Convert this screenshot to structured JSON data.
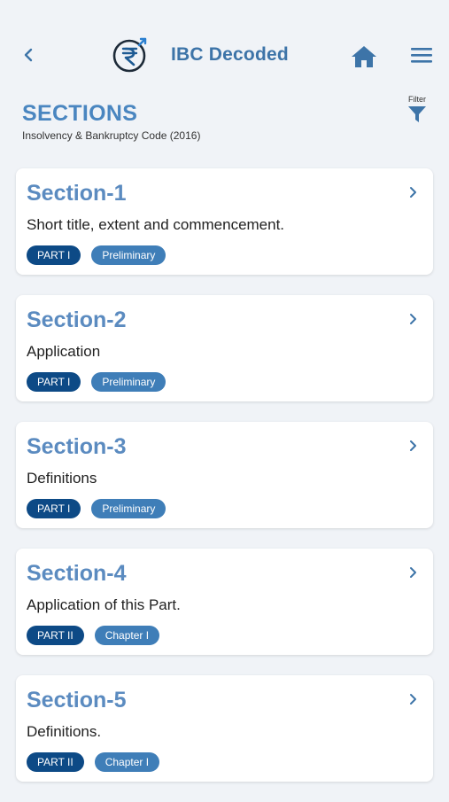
{
  "header": {
    "title": "IBC Decoded",
    "logo_icon": "rupee-icon",
    "accent": "#3d74a8"
  },
  "page": {
    "heading": "SECTIONS",
    "subheading": "Insolvency & Bankruptcy Code (2016)",
    "filter_label": "Filter"
  },
  "sections": [
    {
      "title": "Section-1",
      "description": "Short title, extent and commencement.",
      "part": "PART I",
      "chapter": "Preliminary"
    },
    {
      "title": "Section-2",
      "description": "Application",
      "part": "PART I",
      "chapter": "Preliminary"
    },
    {
      "title": "Section-3",
      "description": "Definitions",
      "part": "PART I",
      "chapter": "Preliminary"
    },
    {
      "title": "Section-4",
      "description": "Application of this Part.",
      "part": "PART II",
      "chapter": "Chapter I"
    },
    {
      "title": "Section-5",
      "description": "Definitions.",
      "part": "PART II",
      "chapter": "Chapter I"
    }
  ],
  "colors": {
    "background": "#f0f3f7",
    "section_title": "#5b8bc0",
    "part_tag": "#0d4a86",
    "chapter_tag": "#3f7eb8"
  }
}
